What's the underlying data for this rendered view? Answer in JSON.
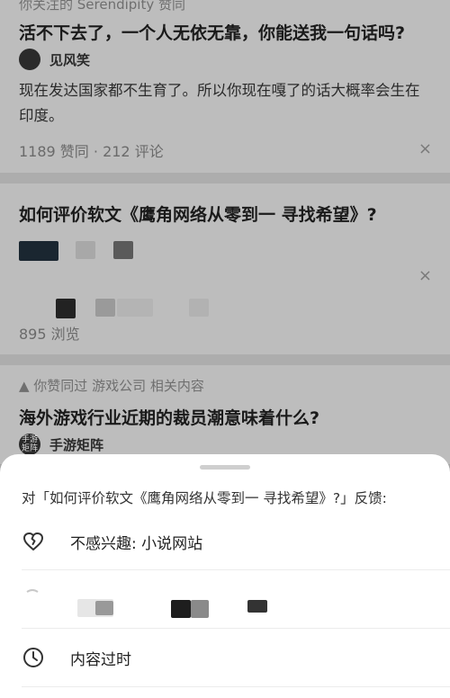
{
  "feed": {
    "card1": {
      "meta": "你关注的 Serendipity 赞同",
      "title": "活不下去了，一个人无依无靠，你能送我一句话吗?",
      "author": "见风笑",
      "excerpt": "现在发达国家都不生育了。所以你现在嘎了的话大概率会生在印度。",
      "stats": "1189 赞同 · 212 评论",
      "close": "×"
    },
    "card2": {
      "title": "如何评价软文《鹰角网络从零到一 寻找希望》?",
      "stats": "895 浏览",
      "close": "×"
    },
    "card3": {
      "meta": "▲ 你赞同过 游戏公司 相关内容",
      "title": "海外游戏行业近期的裁员潮意味着什么?",
      "author": "手游矩阵",
      "avatar_text": "手游\n矩阵"
    }
  },
  "sheet": {
    "title": "对「如何评价软文《鹰角网络从零到一 寻找希望》?」反馈:",
    "options": [
      {
        "icon": "broken-heart-icon",
        "label": "不感兴趣: 小说网站"
      },
      {
        "icon": "blurred-option-icon",
        "label": ""
      },
      {
        "icon": "clock-icon",
        "label": "内容过时"
      }
    ]
  },
  "colors": {
    "overlay": "#a6a6a6",
    "sheet_bg": "#ffffff",
    "text_primary": "#222222",
    "handle": "#cfcfcf"
  }
}
